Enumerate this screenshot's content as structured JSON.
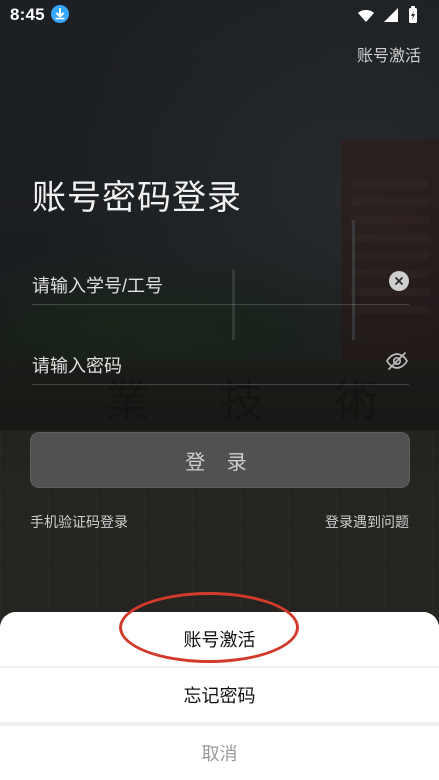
{
  "status_bar": {
    "time": "8:45",
    "download_icon": "download-badge-icon",
    "wifi_icon": "wifi-icon",
    "signal_icon": "signal-icon",
    "battery_icon": "battery-charging-icon"
  },
  "header": {
    "top_right_link": "账号激活"
  },
  "page": {
    "title": "账号密码登录",
    "username_placeholder": "请输入学号/工号",
    "password_placeholder": "请输入密码",
    "login_button": "登 录",
    "sms_login_link": "手机验证码登录",
    "help_link": "登录遇到问题"
  },
  "background": {
    "stone_chars": [
      "業",
      "技",
      "術"
    ]
  },
  "bottom_sheet": {
    "option_activate": "账号激活",
    "option_forgot": "忘记密码",
    "cancel": "取消"
  },
  "colors": {
    "primary_text": "#111111",
    "cancel_text": "#9a9a9a",
    "highlight": "#d23b2b",
    "download_badge": "#3aa7ff"
  }
}
